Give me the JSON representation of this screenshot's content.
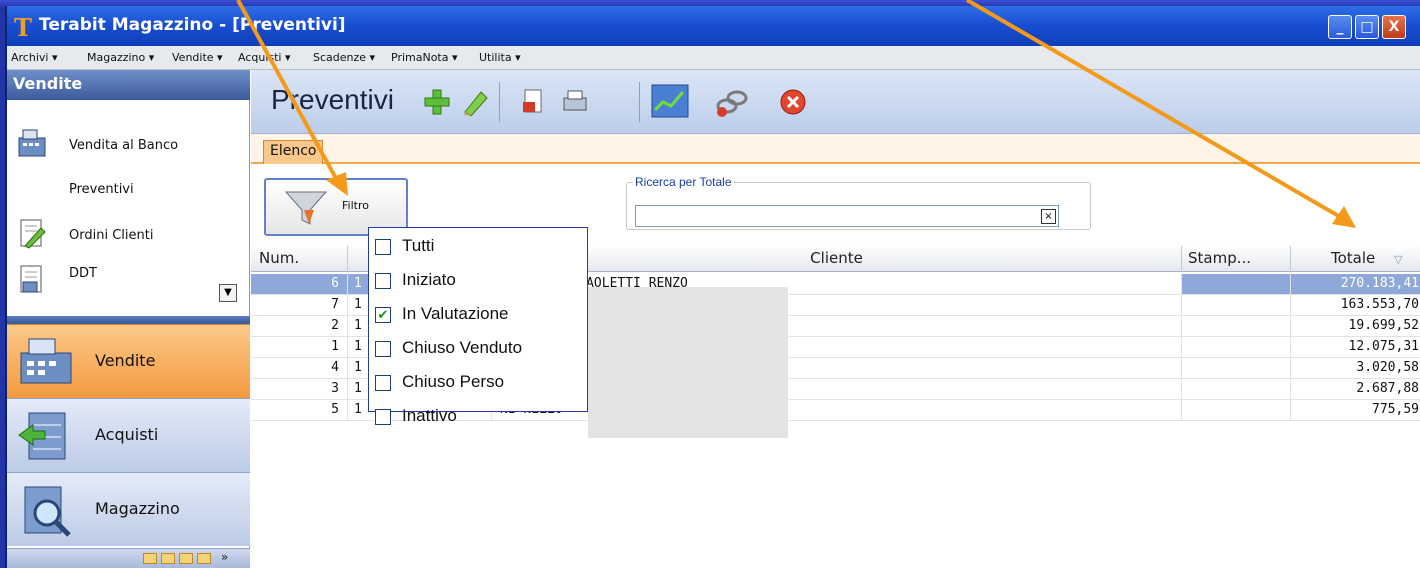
{
  "window": {
    "title": "Terabit Magazzino - [Preventivi]",
    "logo_letter": "T"
  },
  "menubar": [
    "Archivi ▾",
    "Magazzino ▾",
    "Vendite ▾",
    "Acquisti ▾",
    "Scadenze ▾",
    "PrimaNota ▾",
    "Utilita ▾"
  ],
  "sidebar": {
    "header": "Vendite",
    "items": [
      {
        "label": "Vendita al Banco",
        "icon": "cash-register-icon"
      },
      {
        "label": "Preventivi",
        "icon": ""
      },
      {
        "label": "Ordini Clienti",
        "icon": "document-pencil-icon"
      },
      {
        "label": "DDT",
        "icon": "document-truck-icon"
      }
    ],
    "nav": [
      {
        "label": "Vendite",
        "active": true
      },
      {
        "label": "Acquisti",
        "active": false
      },
      {
        "label": "Magazzino",
        "active": false
      }
    ]
  },
  "toolbar": {
    "title": "Preventivi"
  },
  "tabs": {
    "elenco": "Elenco"
  },
  "filter": {
    "button_label": "Filtro",
    "search_legend": "Ricerca per Totale",
    "search_value": "",
    "clear_symbol": "☒"
  },
  "grid": {
    "headers": {
      "num": "Num.",
      "cliente": "Cliente",
      "stamp": "Stamp...",
      "totale": "Totale",
      "sort": "▽"
    },
    "rows": [
      {
        "num": "6",
        "d": "1",
        "cliente": "ΑΖ ΑCD DI PAOLETTI RENZO",
        "cliente_vis": "T.A AZ ACD DI PAOLETTI RENZO",
        "totale": "270.183,41"
      },
      {
        "num": "7",
        "d": "1",
        "cliente": "F",
        "totale": "163.553,70"
      },
      {
        "num": "2",
        "d": "1",
        "cliente": "F",
        "totale": "19.699,52"
      },
      {
        "num": "1",
        "d": "1",
        "cliente": "O",
        "totale": "12.075,31"
      },
      {
        "num": "4",
        "d": "1",
        "cliente": "",
        "totale": "3.020,58"
      },
      {
        "num": "3",
        "d": "1",
        "cliente": "N",
        "totale": "2.687,88"
      },
      {
        "num": "5",
        "d": "1",
        "cliente": "NI NELLO",
        "totale": "775,59"
      }
    ]
  },
  "status_filter": {
    "items": [
      {
        "label": "Tutti",
        "checked": false
      },
      {
        "label": "Iniziato",
        "checked": false
      },
      {
        "label": "In Valutazione",
        "checked": true
      },
      {
        "label": "Chiuso Venduto",
        "checked": false
      },
      {
        "label": "Chiuso Perso",
        "checked": false
      },
      {
        "label": "Inattivo",
        "checked": false
      }
    ]
  },
  "colors": {
    "accent_orange": "#f39a3e",
    "annotation_arrow": "#f39a1a",
    "selection_blue": "#8fa8da"
  }
}
